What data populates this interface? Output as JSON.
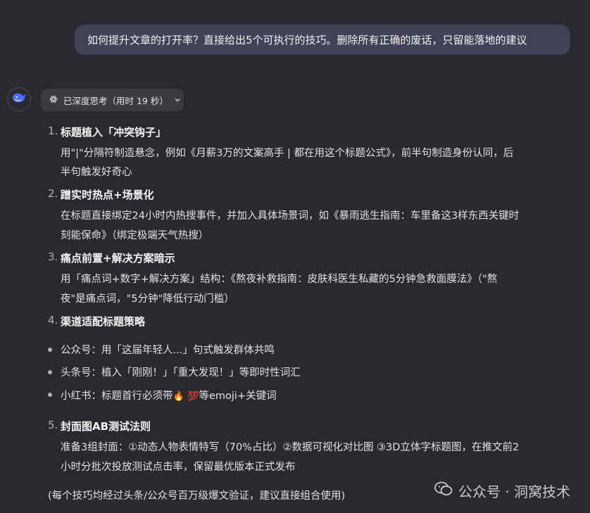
{
  "user_message": "如何提升文章的打开率？直接给出5个可执行的技巧。删除所有正确的废话，只留能落地的建议",
  "thinking": {
    "label": "已深度思考（用时 19 秒）"
  },
  "tips": [
    {
      "number": "1.",
      "title": "标题植入「冲突钩子」",
      "lines": [
        "用\"|\"分隔符制造悬念，例如《月薪3万的文案高手 | 都在用这个标题公式》，前半句制造身份认同，后",
        "半句触发好奇心"
      ]
    },
    {
      "number": "2.",
      "title": "蹭实时热点+场景化",
      "lines": [
        "在标题直接绑定24小时内热搜事件，并加入具体场景词，如《暴雨逃生指南：车里备这3样东西关键时",
        "刻能保命》（绑定极端天气热搜）"
      ]
    },
    {
      "number": "3.",
      "title": "痛点前置+解决方案暗示",
      "lines": [
        "用「痛点词+数字+解决方案」结构：《熬夜补救指南：皮肤科医生私藏的5分钟急救面膜法》（\"熬",
        "夜\"是痛点词，\"5分钟\"降低行动门槛）"
      ]
    },
    {
      "number": "4.",
      "title": "渠道适配标题策略",
      "lines": []
    },
    {
      "number": "5.",
      "title": "封面图AB测试法则",
      "lines": [
        "准备3组封面：①动态人物表情特写（70%占比）②数据可视化对比图 ③3D立体字标题图，在推文前2",
        "小时分批次投放测试点击率，保留最优版本正式发布"
      ]
    }
  ],
  "channels": [
    {
      "text": "公众号：用「这届年轻人...」句式触发群体共鸣"
    },
    {
      "text": "头条号：植入「刚刚！」「重大发现！」等即时性词汇"
    },
    {
      "text_before": "小红书：标题首行必须带",
      "emoji1": "🔥",
      "emoji2": "💯",
      "text_after": "等emoji+关键词"
    }
  ],
  "footer": "(每个技巧均经过头条/公众号百万级爆文验证，建议直接组合使用)",
  "watermark": "公众号 · 洞窝技术",
  "colors": {
    "background": "#292a2d",
    "user_bubble": "#414158",
    "think_button": "#3b3c42",
    "brand": "#4d6bfe"
  }
}
